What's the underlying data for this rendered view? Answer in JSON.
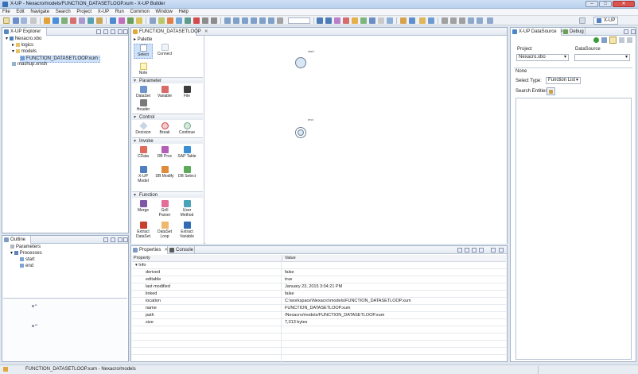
{
  "window": {
    "title": "X-UP - Nexacro/models/FUNCTION_DATASETLOOP.xum - X-UP Builder",
    "min": "–",
    "max": "□",
    "close": "✕"
  },
  "menu": [
    "File",
    "Edit",
    "Navigate",
    "Search",
    "Project",
    "X-UP",
    "Run",
    "Common",
    "Window",
    "Help"
  ],
  "toolbar": {
    "perspective": "X-UP"
  },
  "explorer": {
    "tab": "X-UP Explorer",
    "items": [
      {
        "label": "Nexacro.xbo"
      },
      {
        "label": "logics"
      },
      {
        "label": "models"
      },
      {
        "label": "FUNCTION_DATASETLOOP.xum"
      },
      {
        "label": "mashup.xmsh"
      }
    ]
  },
  "editor": {
    "tab": "FUNCTION_DATASETLOOP",
    "palette_title": "Palette",
    "tools": [
      {
        "label": "Select"
      },
      {
        "label": "Connect"
      },
      {
        "label": "Note"
      }
    ],
    "groups": [
      {
        "title": "Parameter",
        "items": [
          "DataSet",
          "Variable",
          "File",
          "Header"
        ]
      },
      {
        "title": "Control",
        "items": [
          "Decision",
          "Break",
          "Continue"
        ]
      },
      {
        "title": "Invoke",
        "items": [
          "CData",
          "DB Proc",
          "SAP Table",
          "X-UP Model",
          "DB Modify",
          "DB Select"
        ]
      },
      {
        "title": "Function",
        "items": [
          "Merge",
          "Grill Parser",
          "User Method",
          "Extract DataSet",
          "DataSet Loop",
          "Extract Variable"
        ]
      }
    ],
    "nodes": {
      "start": "start",
      "end": "end"
    }
  },
  "outline": {
    "tab": "Outline",
    "items": [
      {
        "label": "Parameters"
      },
      {
        "label": "Processes"
      },
      {
        "label": "start"
      },
      {
        "label": "end"
      }
    ],
    "mini_labels": [
      "st",
      "en"
    ]
  },
  "properties": {
    "tab": "Properties",
    "console_tab": "Console",
    "col_property": "Property",
    "col_value": "Value",
    "section": "Info",
    "rows": [
      {
        "k": "derived",
        "v": "false"
      },
      {
        "k": "editable",
        "v": "true"
      },
      {
        "k": "last modified",
        "v": "January 23, 2015 3:04:21 PM"
      },
      {
        "k": "linked",
        "v": "false"
      },
      {
        "k": "location",
        "v": "C:\\workspace\\Nexacro\\models\\FUNCTION_DATASETLOOP.xum"
      },
      {
        "k": "name",
        "v": "FUNCTION_DATASETLOOP.xum"
      },
      {
        "k": "path",
        "v": "/Nexacro/models/FUNCTION_DATASETLOOP.xum"
      },
      {
        "k": "size",
        "v": "7,013 bytes"
      }
    ]
  },
  "datasource": {
    "tab": "X-UP DataSource",
    "debug_tab": "Debug",
    "project_label": "Project",
    "project_value": "Nexacro.xbo",
    "datasource_label": "DataSource",
    "datasource_value": "",
    "section": "None",
    "select_type_label": "Select Type:",
    "select_type_value": "Function List",
    "search_label": "Search Entities:"
  },
  "status": {
    "text": "FUNCTION_DATASETLOOP.xum - Nexacro/models"
  },
  "colors": {
    "node_fill": "#d9e6f4",
    "node_stroke": "#6d7f96",
    "selection": "#cfe2fb"
  }
}
